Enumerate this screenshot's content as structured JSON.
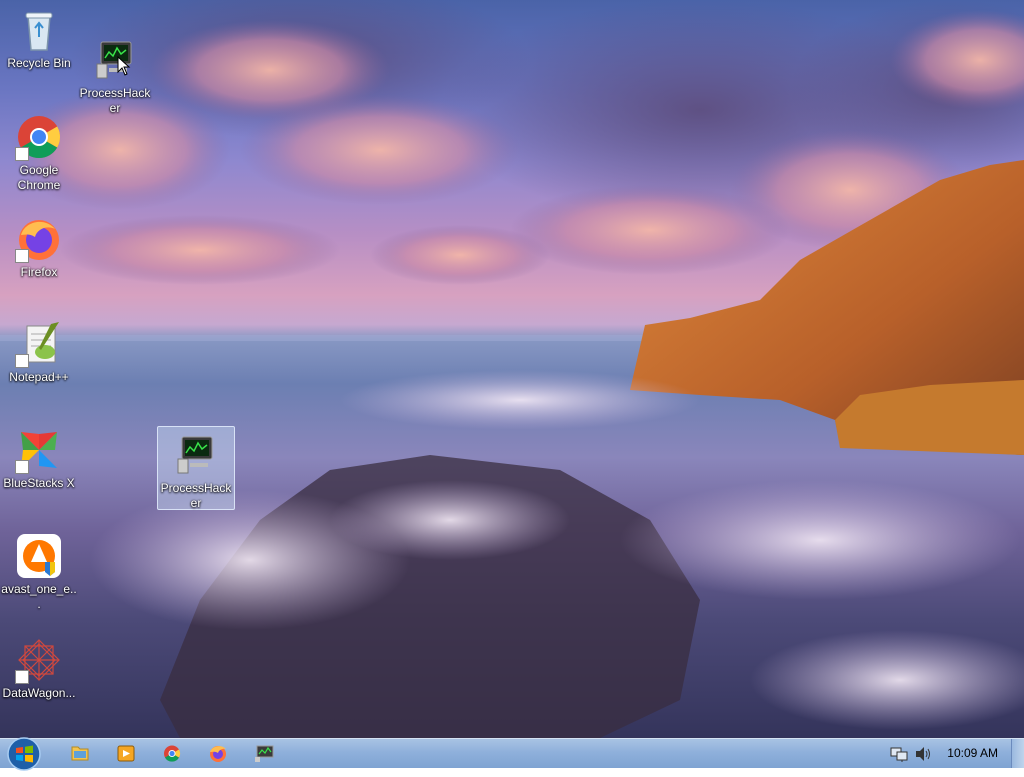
{
  "desktop": {
    "icons": [
      {
        "label": "Recycle Bin",
        "icon": "recycle-bin-icon"
      },
      {
        "label": "ProcessHacker",
        "icon": "process-hacker-icon"
      },
      {
        "label": "Google Chrome",
        "icon": "chrome-icon"
      },
      {
        "label": "Firefox",
        "icon": "firefox-icon"
      },
      {
        "label": "Notepad++",
        "icon": "notepad-plus-plus-icon"
      },
      {
        "label": "BlueStacks X",
        "icon": "bluestacks-icon"
      },
      {
        "label": "avast_one_e...",
        "icon": "avast-icon"
      },
      {
        "label": "DataWagon...",
        "icon": "datawagon-icon"
      },
      {
        "label": "ProcessHacker",
        "icon": "process-hacker-icon"
      }
    ]
  },
  "taskbar": {
    "start_icon": "windows-start-orb-icon",
    "pinned": [
      {
        "icon": "file-explorer-icon"
      },
      {
        "icon": "media-player-icon"
      },
      {
        "icon": "chrome-icon"
      },
      {
        "icon": "firefox-icon"
      },
      {
        "icon": "process-hacker-icon"
      }
    ],
    "tray": {
      "network_icon": "network-icon",
      "volume_icon": "volume-icon",
      "clock": "10:09 AM"
    }
  },
  "colors": {
    "taskbar": "#8fb0db",
    "selection": "#c8dcf5"
  }
}
